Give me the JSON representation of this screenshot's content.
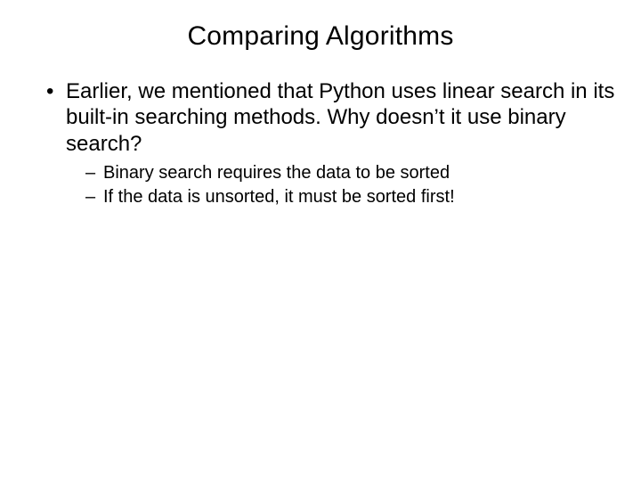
{
  "slide": {
    "title": "Comparing Algorithms",
    "bullets": [
      {
        "text": "Earlier, we mentioned that Python uses linear search in its built-in searching methods. Why doesn’t it use binary search?",
        "sub": [
          "Binary search requires the data to be sorted",
          "If the data is unsorted, it must be sorted first!"
        ]
      }
    ]
  }
}
